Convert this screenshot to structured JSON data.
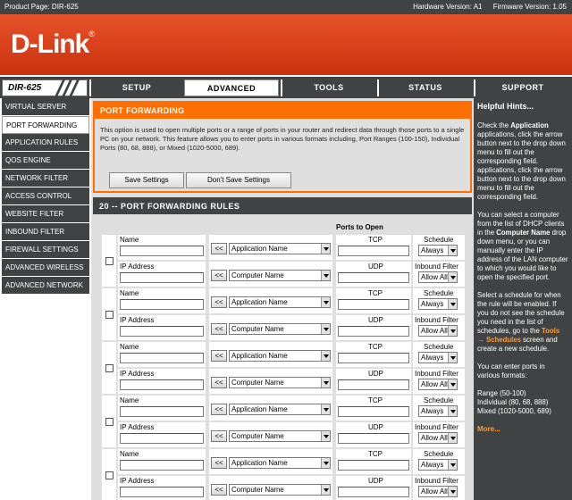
{
  "header": {
    "product_page": "Product Page: DIR-625",
    "hardware_version": "Hardware Version: A1",
    "firmware_version": "Firmware Version: 1.05"
  },
  "brand": {
    "logo": "D-Link",
    "model": "DIR-625"
  },
  "tabs": [
    {
      "label": "SETUP",
      "active": false
    },
    {
      "label": "ADVANCED",
      "active": true
    },
    {
      "label": "TOOLS",
      "active": false
    },
    {
      "label": "STATUS",
      "active": false
    },
    {
      "label": "SUPPORT",
      "active": false
    }
  ],
  "sidebar": {
    "items": [
      {
        "label": "VIRTUAL SERVER"
      },
      {
        "label": "PORT FORWARDING"
      },
      {
        "label": "APPLICATION RULES"
      },
      {
        "label": "QOS ENGINE"
      },
      {
        "label": "NETWORK FILTER"
      },
      {
        "label": "ACCESS CONTROL"
      },
      {
        "label": "WEBSITE FILTER"
      },
      {
        "label": "INBOUND FILTER"
      },
      {
        "label": "FIREWALL SETTINGS"
      },
      {
        "label": "ADVANCED WIRELESS"
      },
      {
        "label": "ADVANCED NETWORK"
      }
    ]
  },
  "port_forwarding": {
    "title": "PORT FORWARDING",
    "description": "This option is used to open multiple ports or a range of ports in your router and redirect data through those ports to a single PC on your network. This feature allows you to enter ports in various formats including, Port Ranges (100-150), Individual Ports (80, 68, 888), or Mixed (1020-5000, 689).",
    "save_label": "Save Settings",
    "dont_save_label": "Don't Save Settings"
  },
  "rules": {
    "title": "20 -- PORT FORWARDING RULES",
    "ports_to_open": "Ports to Open",
    "labels": {
      "name": "Name",
      "ip": "IP Address",
      "tcp": "TCP",
      "udp": "UDP",
      "schedule": "Schedule",
      "inbound": "Inbound Filter",
      "copy": "<<"
    },
    "rows": [
      {
        "app": "Application Name",
        "computer": "Computer Name",
        "schedule": "Always",
        "inbound": "Allow All"
      },
      {
        "app": "Application Name",
        "computer": "Computer Name",
        "schedule": "Always",
        "inbound": "Allow All"
      },
      {
        "app": "Application Name",
        "computer": "Computer Name",
        "schedule": "Always",
        "inbound": "Allow All"
      },
      {
        "app": "Application Name",
        "computer": "Computer Name",
        "schedule": "Always",
        "inbound": "Allow All"
      },
      {
        "app": "Application Name",
        "computer": "Computer Name",
        "schedule": "Always",
        "inbound": "Allow All"
      }
    ]
  },
  "hints": {
    "title": "Helpful Hints...",
    "p1_a": "Check the ",
    "p1_b": "Application",
    "p1_c": " applications, click the arrow button next to the drop down menu to fill out the corresponding field. applications, click the arrow button next to the drop down menu to fill out the corresponding field.",
    "p2_a": "You can select a computer from the list of DHCP clients in the ",
    "p2_b": "Computer Name",
    "p2_c": " drop down menu, or you can manually enter the IP address of the LAN computer to which you would like to open the specified port.",
    "p3_a": "Select a schedule for when the rule will be enabled. If you do not see the schedule you need in the list of schedules, go to the ",
    "p3_b": "Tools → Schedules",
    "p3_c": " screen and create a new schedule.",
    "p4": "You can enter ports in various formats:",
    "p5_1": "Range (50-100)",
    "p5_2": "Individual (80, 68, 888)",
    "p5_3": "Mixed (1020-5000, 689)",
    "more": "More..."
  }
}
